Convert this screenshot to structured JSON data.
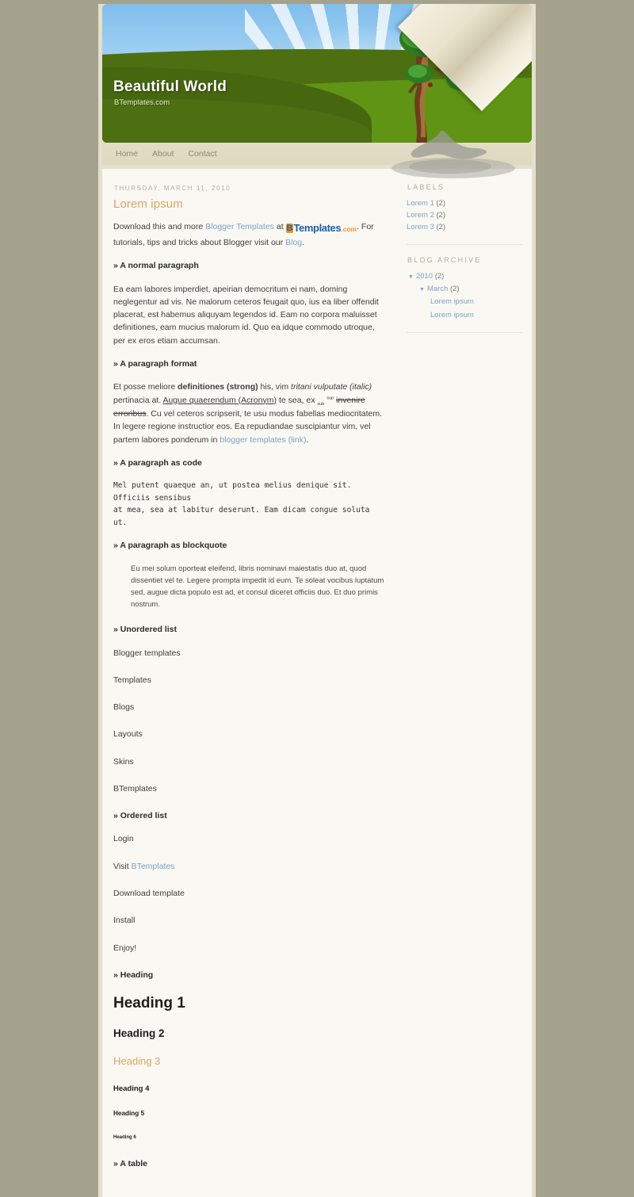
{
  "theme": {
    "page_bg": "#a4a18d",
    "wrapper_bg": "#e4e0cd",
    "content_bg": "#faf8f2",
    "accent": "#d9a566",
    "link": "#7ba3c9",
    "muted": "#b4b0a2"
  },
  "header": {
    "title": "Beautiful World",
    "description": "BTemplates.com"
  },
  "nav": {
    "items": [
      {
        "label": "Home"
      },
      {
        "label": "About"
      },
      {
        "label": "Contact"
      }
    ]
  },
  "post": {
    "date": "THURSDAY, MARCH 11, 2010",
    "title": "Lorem ipsum",
    "intro": {
      "part1": "Download this and more ",
      "link1": "Blogger Templates",
      "part2": " at ",
      "logo": {
        "b": "B",
        "word": "Templates",
        "com": ".com"
      },
      "part3": ". For tutorials, tips and tricks about Blogger visit our ",
      "link2": "Blog",
      "part4": "."
    },
    "sections": {
      "normal_paragraph": {
        "heading": "A normal paragraph",
        "text": "Ea eam labores imperdiet, apeirian democritum ei nam, doming neglegentur ad vis. Ne malorum ceteros feugait quo, ius ea liber offendit placerat, est habemus aliquyam legendos id. Eam no corpora maluisset definitiones, eam mucius malorum id. Quo ea idque commodo utroque, per ex eros etiam accumsan."
      },
      "paragraph_format": {
        "heading": "A paragraph format",
        "t1": "Et posse meliore ",
        "strong": "definitiones (strong)",
        "t2": " his, vim ",
        "italic": "tritani vulputate (italic)",
        "t3": " pertinacia at. ",
        "acronym": "Augue quaerendum (Acronym)",
        "t4": " te sea, ex ",
        "sub": "sub",
        "t5": " ",
        "sup": "sup",
        "t6": " ",
        "strike": "invenire erroribus",
        "t7": ". Cu vel ceteros scripserit, te usu modus fabellas mediocritatem. In legere regione instructior eos. Ea repudiandae suscipiantur vim, vel partem labores ponderum in ",
        "link": "blogger templates (link)",
        "t8": "."
      },
      "paragraph_code": {
        "heading": "A paragraph as code",
        "code": "Mel putent quaeque an, ut postea melius denique sit. Officiis sensibus\nat mea, sea at labitur deserunt. Eam dicam congue soluta ut."
      },
      "paragraph_blockquote": {
        "heading": "A paragraph as blockquote",
        "quote": "Eu mei solum oporteat eleifend, libris nominavi maiestatis duo at, quod dissentiet vel te. Legere prompta impedit id eum. Te soleat vocibus luptatum sed, augue dicta populo est ad, et consul diceret officiis duo. Et duo primis nostrum."
      },
      "unordered_list": {
        "heading": "Unordered list",
        "items": [
          "Blogger templates",
          "Templates",
          "Blogs",
          "Layouts",
          "Skins",
          "BTemplates"
        ]
      },
      "ordered_list": {
        "heading": "Ordered list",
        "items": [
          {
            "text": "Login"
          },
          {
            "prefix": "Visit ",
            "link": "BTemplates"
          },
          {
            "text": "Download template"
          },
          {
            "text": "Install"
          },
          {
            "text": "Enjoy!"
          }
        ]
      },
      "headings": {
        "heading": "Heading",
        "h1": "Heading 1",
        "h2": "Heading 2",
        "h3": "Heading 3",
        "h4": "Heading 4",
        "h5": "Heading 5",
        "h6": "Heading 6"
      },
      "table": {
        "heading": "A table"
      }
    }
  },
  "sidebar": {
    "labels": {
      "title": "LABELS",
      "items": [
        {
          "name": "Lorem 1",
          "count": "(2)"
        },
        {
          "name": "Lorem 2",
          "count": "(2)"
        },
        {
          "name": "Lorem 3",
          "count": "(2)"
        }
      ]
    },
    "archive": {
      "title": "BLOG ARCHIVE",
      "year": {
        "label": "2010",
        "count": "(2)",
        "marker": "▼"
      },
      "month": {
        "label": "March",
        "count": "(2)",
        "marker": "▼"
      },
      "posts": [
        {
          "label": "Lorem ipsum"
        },
        {
          "label": "Lorem ipsum"
        }
      ]
    }
  }
}
